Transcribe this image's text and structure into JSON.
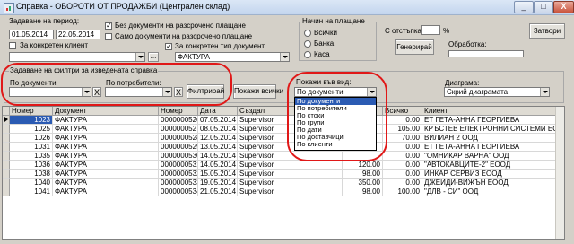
{
  "window": {
    "title": "Справка - ОБОРОТИ ОТ ПРОДАЖБИ (Централен склад)",
    "min": "_",
    "max": "□",
    "close": "X"
  },
  "period": {
    "label": "Задаване на период:",
    "from": "01.05.2014",
    "to": "22.05.2014"
  },
  "client": {
    "label": "За конкретен клиент",
    "value": "",
    "ellipsis": "..."
  },
  "checks": {
    "no_deferred": "Без документи на разсрочено плащане",
    "only_deferred": "Само документи на разсрочено плащане",
    "doc_type": "За конкретен тип документ",
    "doc_type_value": "ФАКТУРА",
    "check_mark": "✓"
  },
  "payment": {
    "label": "Начин на плащане",
    "options": [
      "Всички",
      "Банка",
      "Каса"
    ]
  },
  "discount": {
    "label": "С отстъпка:",
    "unit": "%",
    "value": ""
  },
  "generate_button": "Генерирай",
  "processing_label": "Обработка:",
  "exit_button": "Затвори",
  "filters": {
    "title": "Задаване на филтри за изведената справка",
    "by_document": "По документи:",
    "by_user": "По потребители:",
    "clear": "X",
    "filter_button": "Филтрирай",
    "show_all_button": "Покажи всички"
  },
  "view": {
    "label": "Покажи във вид:",
    "selected": "По документи",
    "options": [
      "По документи",
      "По потребители",
      "По стоки",
      "По групи",
      "По дати",
      "По доставчици",
      "По клиенти"
    ]
  },
  "diagram": {
    "label": "Диаграма:",
    "selected": "Скрий диаграмата"
  },
  "table": {
    "headers": [
      "Номер",
      "Документ",
      "Номер",
      "Дата",
      "Създал",
      "",
      "Всичко",
      "Клиент"
    ],
    "rows": [
      {
        "id": "1023",
        "doc": "ФАКТУРА",
        "num": "0000000526",
        "date": "07.05.2014",
        "user": "Supervisor",
        "v1": "",
        "v2": "0.00",
        "client": "ЕТ ГЕТА-АННА ГЕОРГИЕВА"
      },
      {
        "id": "1025",
        "doc": "ФАКТУРА",
        "num": "0000000527",
        "date": "08.05.2014",
        "user": "Supervisor",
        "v1": "",
        "v2": "105.00",
        "client": "КРЪСТЕВ ЕЛЕКТРОННИ СИСТЕМИ ЕООД"
      },
      {
        "id": "1026",
        "doc": "ФАКТУРА",
        "num": "0000000528",
        "date": "12.05.2014",
        "user": "Supervisor",
        "v1": "",
        "v2": "70.00",
        "client": "ВИЛИАН 2 ООД"
      },
      {
        "id": "1031",
        "doc": "ФАКТУРА",
        "num": "0000000529",
        "date": "13.05.2014",
        "user": "Supervisor",
        "v1": "",
        "v2": "0.00",
        "client": "ЕТ ГЕТА-АННА ГЕОРГИЕВА"
      },
      {
        "id": "1035",
        "doc": "ФАКТУРА",
        "num": "0000000530",
        "date": "14.05.2014",
        "user": "Supervisor",
        "v1": "",
        "v2": "0.00",
        "client": "\"ОМНИКАР ВАРНА\" ООД"
      },
      {
        "id": "1036",
        "doc": "ФАКТУРА",
        "num": "0000000531",
        "date": "14.05.2014",
        "user": "Supervisor",
        "v1": "120.00",
        "v2": "0.00",
        "client": "\"АВТОКАВЦИТЕ-2\" ЕООД"
      },
      {
        "id": "1038",
        "doc": "ФАКТУРА",
        "num": "0000000532",
        "date": "15.05.2014",
        "user": "Supervisor",
        "v1": "98.00",
        "v2": "0.00",
        "client": "ИНКАР СЕРВИЗ ЕООД"
      },
      {
        "id": "1040",
        "doc": "ФАКТУРА",
        "num": "0000000533",
        "date": "19.05.2014",
        "user": "Supervisor",
        "v1": "350.00",
        "v2": "0.00",
        "client": "ДЖЕЙДИ-ВИЖЪН ЕООД"
      },
      {
        "id": "1041",
        "doc": "ФАКТУРА",
        "num": "0000000534",
        "date": "21.05.2014",
        "user": "Supervisor",
        "v1": "98.00",
        "v2": "100.00",
        "client": "\"ДЛВ - СИ\" ООД"
      }
    ]
  },
  "colors": {
    "selection": "#2b5bb3",
    "annotation_ring": "#e01818",
    "window_bg": "#d4d0c8"
  }
}
